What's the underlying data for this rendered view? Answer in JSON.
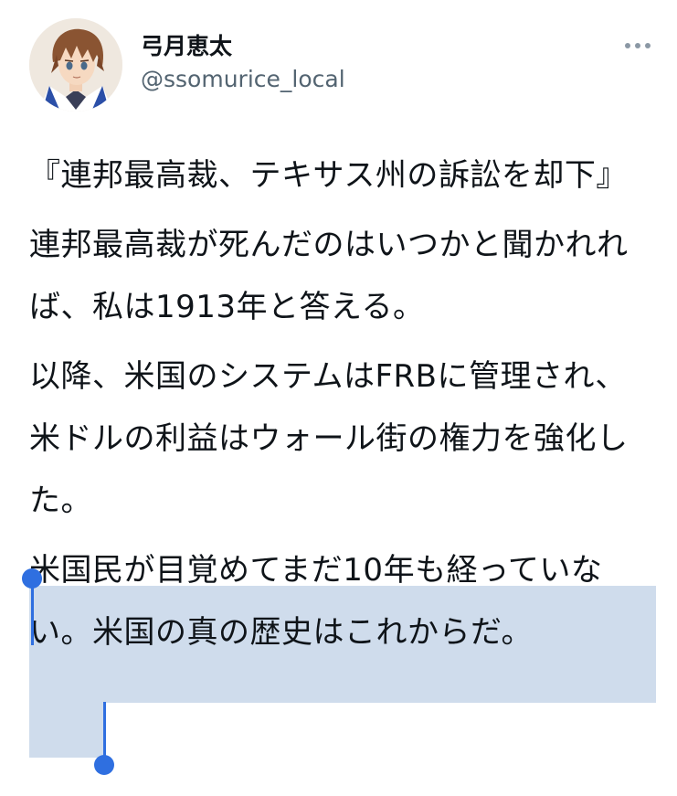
{
  "user": {
    "display_name": "弓月恵太",
    "handle": "@ssomurice_local",
    "avatar_icon": "anime-character-avatar"
  },
  "more_icon": "more-horizontal-icon",
  "tweet": {
    "paragraphs": [
      "『連邦最高裁、テキサス州の訴訟を却下』",
      "連邦最高裁が死んだのはいつかと聞かれれば、私は1913年と答える。",
      "以降、米国のシステムはFRBに管理され、米ドルの利益はウォール街の権力を強化した。",
      "米国民が目覚めてまだ10年も経っていない。米国の真の歴史はこれからだ。"
    ]
  },
  "selection": {
    "color": "#cfdcec",
    "handle_color": "#2f6fe0"
  }
}
